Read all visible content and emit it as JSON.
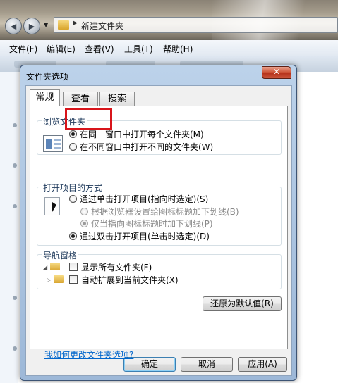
{
  "explorer": {
    "breadcrumb": "新建文件夹",
    "menu": [
      "文件(F)",
      "编辑(E)",
      "查看(V)",
      "工具(T)",
      "帮助(H)"
    ]
  },
  "dialog": {
    "title": "文件夹选项",
    "close_label": "✕",
    "tabs": [
      "常规",
      "查看",
      "搜索"
    ],
    "active_tab": "常规",
    "browse_folders": {
      "title": "浏览文件夹",
      "options": [
        {
          "label": "在同一窗口中打开每个文件夹(M)",
          "checked": true
        },
        {
          "label": "在不同窗口中打开不同的文件夹(W)",
          "checked": false
        }
      ]
    },
    "click_items": {
      "title": "打开项目的方式",
      "options": [
        {
          "label": "通过单击打开项目(指向时选定)(S)",
          "checked": false,
          "enabled": true
        },
        {
          "label": "根据浏览器设置给图标标题加下划线(B)",
          "checked": false,
          "enabled": false
        },
        {
          "label": "仅当指向图标标题时加下划线(P)",
          "checked": true,
          "enabled": false
        },
        {
          "label": "通过双击打开项目(单击时选定)(D)",
          "checked": true,
          "enabled": true
        }
      ]
    },
    "navigation_pane": {
      "title": "导航窗格",
      "options": [
        {
          "label": "显示所有文件夹(F)",
          "checked": false
        },
        {
          "label": "自动扩展到当前文件夹(X)",
          "checked": false
        }
      ]
    },
    "restore_defaults_label": "还原为默认值(R)",
    "help_link": "我如何更改文件夹选项?",
    "buttons": {
      "ok": "确定",
      "cancel": "取消",
      "apply": "应用(A)"
    }
  },
  "colors": {
    "highlight_box": "#d8151b",
    "close_button": "#c9533a",
    "link": "#0066cc"
  }
}
